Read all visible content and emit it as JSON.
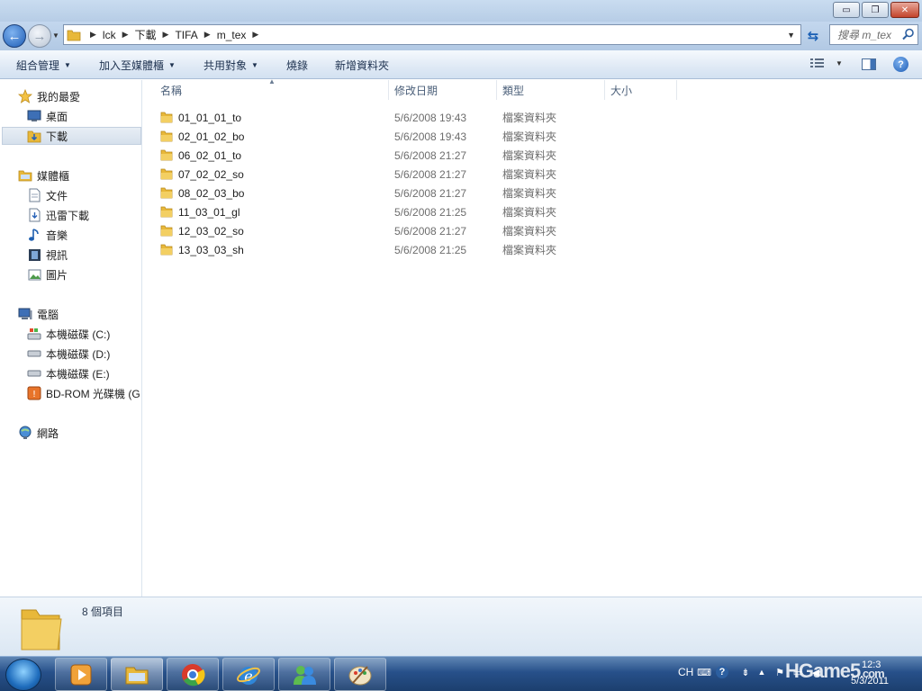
{
  "window": {
    "minimize_label": "▭",
    "maximize_label": "❐",
    "close_label": "✕"
  },
  "address": {
    "breadcrumbs": [
      "lck",
      "下載",
      "TIFA",
      "m_tex"
    ],
    "search_placeholder": "搜尋 m_tex"
  },
  "toolbar": {
    "organize": "組合管理",
    "add_to_library": "加入至媒體櫃",
    "share_with": "共用對象",
    "burn": "燒錄",
    "new_folder": "新增資料夾"
  },
  "nav": {
    "favorites": "我的最愛",
    "desktop": "桌面",
    "downloads": "下載",
    "libraries": "媒體櫃",
    "documents": "文件",
    "xunlei": "迅雷下載",
    "music": "音樂",
    "videos": "視訊",
    "pictures": "圖片",
    "computer": "電腦",
    "drive_c": "本機磁碟 (C:)",
    "drive_d": "本機磁碟 (D:)",
    "drive_e": "本機磁碟 (E:)",
    "bdrom": "BD-ROM 光碟機 (G",
    "network": "網路"
  },
  "columns": {
    "name": "名稱",
    "date": "修改日期",
    "type": "類型",
    "size": "大小"
  },
  "files": [
    {
      "name": "01_01_01_to",
      "date": "5/6/2008 19:43",
      "type": "檔案資料夾"
    },
    {
      "name": "02_01_02_bo",
      "date": "5/6/2008 19:43",
      "type": "檔案資料夾"
    },
    {
      "name": "06_02_01_to",
      "date": "5/6/2008 21:27",
      "type": "檔案資料夾"
    },
    {
      "name": "07_02_02_so",
      "date": "5/6/2008 21:27",
      "type": "檔案資料夾"
    },
    {
      "name": "08_02_03_bo",
      "date": "5/6/2008 21:27",
      "type": "檔案資料夾"
    },
    {
      "name": "11_03_01_gl",
      "date": "5/6/2008 21:25",
      "type": "檔案資料夾"
    },
    {
      "name": "12_03_02_so",
      "date": "5/6/2008 21:27",
      "type": "檔案資料夾"
    },
    {
      "name": "13_03_03_sh",
      "date": "5/6/2008 21:25",
      "type": "檔案資料夾"
    }
  ],
  "details": {
    "item_count": "8 個項目"
  },
  "taskbar": {
    "lang": "CH",
    "time": "12:3",
    "date": "5/3/2011",
    "watermark_main": "HGame5",
    "watermark_suffix": ".com"
  },
  "icons": {
    "folder": "folder-icon",
    "back": "back-arrow-icon",
    "forward": "forward-arrow-icon",
    "refresh": "refresh-icon",
    "search": "search-icon",
    "help": "help-icon"
  },
  "colors": {
    "folder_yellow": "#e8b83a",
    "selection": "#d6e0ec",
    "taskbar": "#27508a"
  }
}
